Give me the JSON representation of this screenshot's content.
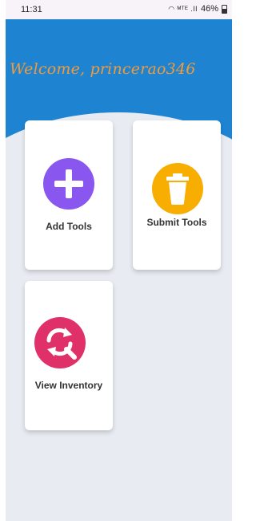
{
  "status": {
    "time": "11:31",
    "glyphs": "◠ ᴹᵀᴱ .ǀǀ",
    "battery": "46%"
  },
  "header": {
    "welcome": "Welcome, princerao346"
  },
  "cards": [
    {
      "label": "Add Tools",
      "icon": "plus-icon",
      "color": "#8a56f0"
    },
    {
      "label": "Submit Tools",
      "icon": "trash-icon",
      "color": "#f8ae00"
    },
    {
      "label": "View Inventory",
      "icon": "refresh-search-icon",
      "color": "#e0306a"
    }
  ],
  "colors": {
    "banner": "#1e84d2",
    "background": "#e8ecf2",
    "welcome": "#f29a3a"
  }
}
